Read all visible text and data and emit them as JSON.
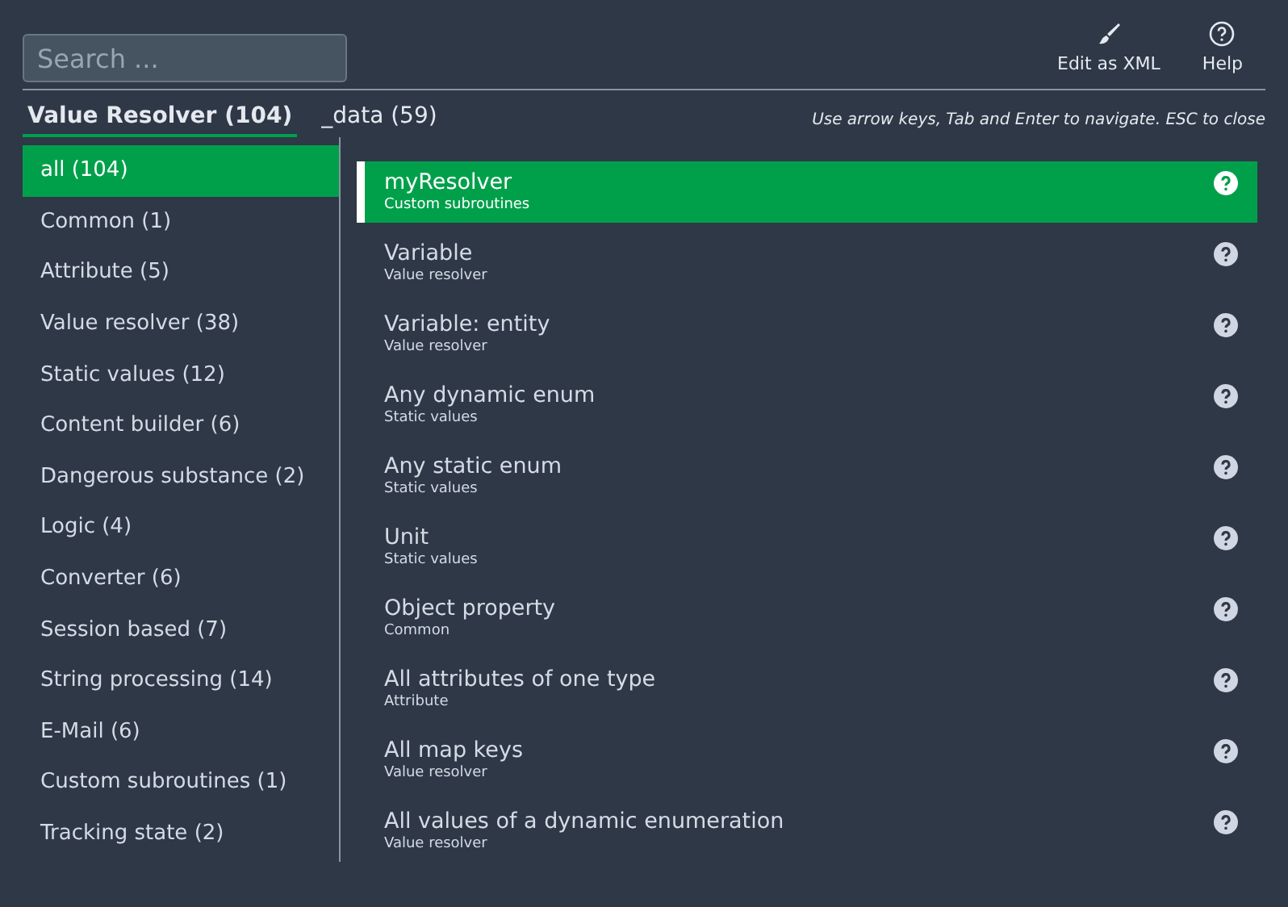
{
  "search": {
    "placeholder": "Search ..."
  },
  "toolbar": [
    {
      "label": "Edit as XML",
      "kind": "edit"
    },
    {
      "label": "Help",
      "kind": "help"
    }
  ],
  "tabs": [
    {
      "label": "Value Resolver (104)",
      "selected": true
    },
    {
      "label": "_data (59)",
      "selected": false
    }
  ],
  "hint": "Use arrow keys, Tab and Enter to navigate. ESC to close",
  "categories": [
    {
      "label": "all (104)",
      "selected": true
    },
    {
      "label": "Common (1)",
      "selected": false
    },
    {
      "label": "Attribute (5)",
      "selected": false
    },
    {
      "label": "Value resolver (38)",
      "selected": false
    },
    {
      "label": "Static values (12)",
      "selected": false
    },
    {
      "label": "Content builder (6)",
      "selected": false
    },
    {
      "label": "Dangerous substance (2)",
      "selected": false
    },
    {
      "label": "Logic (4)",
      "selected": false
    },
    {
      "label": "Converter (6)",
      "selected": false
    },
    {
      "label": "Session based (7)",
      "selected": false
    },
    {
      "label": "String processing (14)",
      "selected": false
    },
    {
      "label": "E-Mail (6)",
      "selected": false
    },
    {
      "label": "Custom subroutines (1)",
      "selected": false
    },
    {
      "label": "Tracking state (2)",
      "selected": false
    }
  ],
  "results": [
    {
      "title": "myResolver",
      "category": "Custom subroutines",
      "selected": true
    },
    {
      "title": "Variable",
      "category": "Value resolver",
      "selected": false
    },
    {
      "title": "Variable: entity",
      "category": "Value resolver",
      "selected": false
    },
    {
      "title": "Any dynamic enum",
      "category": "Static values",
      "selected": false
    },
    {
      "title": "Any static enum",
      "category": "Static values",
      "selected": false
    },
    {
      "title": "Unit",
      "category": "Static values",
      "selected": false
    },
    {
      "title": "Object property",
      "category": "Common",
      "selected": false
    },
    {
      "title": "All attributes of one type",
      "category": "Attribute",
      "selected": false
    },
    {
      "title": "All map keys",
      "category": "Value resolver",
      "selected": false
    },
    {
      "title": "All values of a dynamic enumeration",
      "category": "Value resolver",
      "selected": false
    }
  ]
}
